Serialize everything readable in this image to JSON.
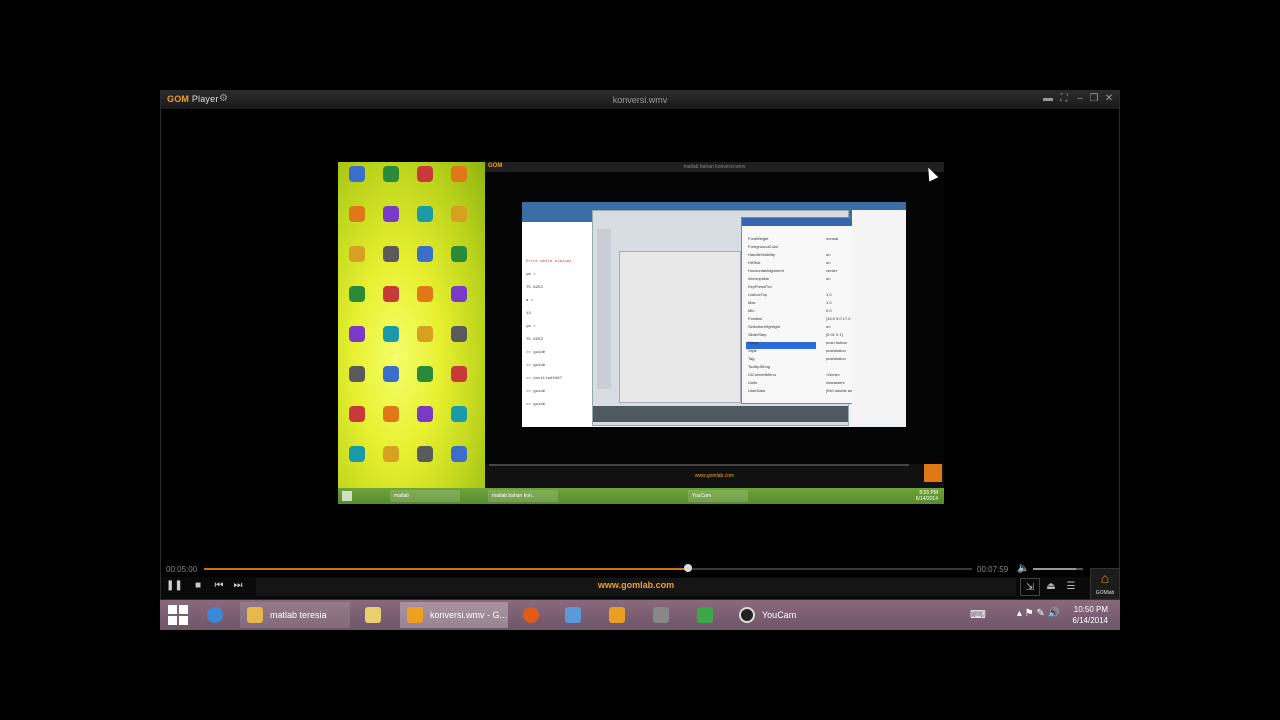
{
  "player": {
    "logo": "GOM",
    "logo_suffix": "Player",
    "title": "konversi.wmv",
    "time_current": "00:05:00",
    "time_total": "00:07:59",
    "progress": 0.63,
    "volume": 0.85,
    "url": "www.gomlab.com",
    "gomlab_label": "GOMlab"
  },
  "video": {
    "inner_title": "matlab bahan konversi.wmv",
    "inner_logo": "GOM",
    "inner_url": "www.gomlab.com",
    "inner_clock_time": "8:55 PM",
    "inner_clock_date": "6/14/2014",
    "inner_task_items": [
      "matlab",
      "matlab bahan kon..",
      "YouCam"
    ],
    "matlab_cmd": [
      "Error while evaluat",
      "ym =",
      "75.6253",
      "a =",
      "13",
      "ym =",
      "75.6253",
      ">> guide",
      ">> guide",
      ">> untitled3467",
      ">> guide",
      ">> guide"
    ],
    "inspector_props": [
      "FontWeight",
      "ForegroundColor",
      "HandleVisibility",
      "HitTest",
      "HorizontalAlignment",
      "Interruptible",
      "KeyPressFcn",
      "ListboxTop",
      "Max",
      "Min",
      "Position",
      "SelectionHighlight",
      "SliderStep",
      "String",
      "Style",
      "Tag",
      "TooltipString",
      "UIContextMenu",
      "Units",
      "UserData"
    ],
    "inspector_values": [
      "normal",
      "",
      "on",
      "on",
      "center",
      "on",
      "",
      "1.0",
      "1.0",
      "0.0",
      "[16.0 9.0 17.0 1.692]",
      "on",
      "[0.01 0.1]",
      "push button",
      "pushbutton",
      "pushbutton",
      "",
      "<None>",
      "characters",
      "[0x0  double array]"
    ]
  },
  "taskbar": {
    "items": [
      {
        "label": "matlab teresia",
        "color": "#e8b84a"
      },
      {
        "label": "",
        "color": "#e8d070"
      },
      {
        "label": "konversi.wmv - G...",
        "color": "#f0a020"
      },
      {
        "label": "",
        "color": "#e05a18"
      },
      {
        "label": "",
        "color": "#5a9ad8"
      },
      {
        "label": "",
        "color": "#e8a020"
      },
      {
        "label": "",
        "color": "#888"
      },
      {
        "label": "",
        "color": "#3aa848"
      },
      {
        "label": "YouCam",
        "color": "#222"
      }
    ],
    "clock_time": "10:50 PM",
    "clock_date": "6/14/2014"
  }
}
